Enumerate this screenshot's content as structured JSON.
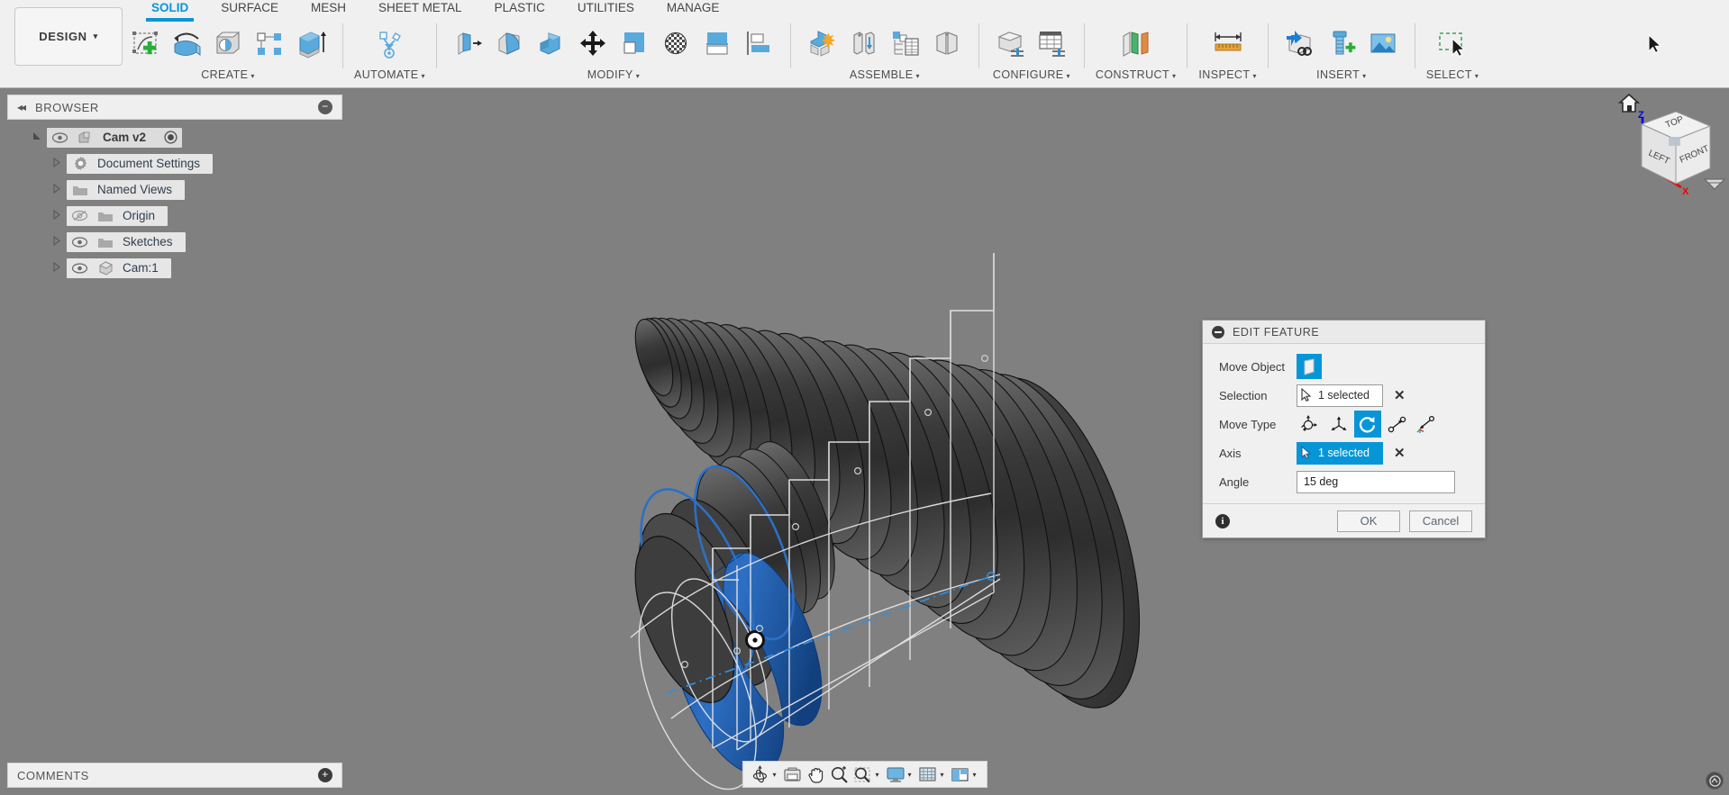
{
  "app": {
    "workspace_label": "DESIGN",
    "workspace_caret": "▾"
  },
  "tabs": [
    {
      "label": "SOLID",
      "active": true
    },
    {
      "label": "SURFACE",
      "active": false
    },
    {
      "label": "MESH",
      "active": false
    },
    {
      "label": "SHEET METAL",
      "active": false
    },
    {
      "label": "PLASTIC",
      "active": false
    },
    {
      "label": "UTILITIES",
      "active": false
    },
    {
      "label": "MANAGE",
      "active": false
    }
  ],
  "ribbon_groups": [
    {
      "name": "CREATE",
      "caret": "▾",
      "tools": [
        "new-sketch-icon",
        "revolve-icon",
        "hole-icon",
        "pattern-icon",
        "extrude-icon"
      ]
    },
    {
      "name": "AUTOMATE",
      "caret": "▾",
      "tools": [
        "automate-icon"
      ]
    },
    {
      "name": "MODIFY",
      "caret": "▾",
      "tools": [
        "press-pull-icon",
        "fillet-icon",
        "shell-icon",
        "move-copy-icon",
        "combine-icon",
        "appearance-icon",
        "align-icon",
        "offset-face-icon"
      ]
    },
    {
      "name": "ASSEMBLE",
      "caret": "▾",
      "tools": [
        "new-component-icon",
        "joint-icon",
        "bom-icon",
        "rigid-group-icon"
      ]
    },
    {
      "name": "CONFIGURE",
      "caret": "▾",
      "tools": [
        "configuration-icon",
        "configuration-table-icon"
      ]
    },
    {
      "name": "CONSTRUCT",
      "caret": "▾",
      "tools": [
        "offset-plane-icon"
      ]
    },
    {
      "name": "INSPECT",
      "caret": "▾",
      "tools": [
        "measure-icon"
      ]
    },
    {
      "name": "INSERT",
      "caret": "▾",
      "tools": [
        "insert-derive-icon",
        "insert-mcmaster-icon",
        "insert-canvas-icon"
      ]
    },
    {
      "name": "SELECT",
      "caret": "▾",
      "tools": [
        "select-window-icon"
      ]
    }
  ],
  "browser": {
    "title": "BROWSER",
    "collapse_icon": "◂◂",
    "minimize_icon": "−",
    "items": [
      {
        "label": "Cam v2",
        "indent": 0,
        "expander": "expanded",
        "eye": "visible",
        "icon": "component-icon",
        "radio": true,
        "bold": true
      },
      {
        "label": "Document Settings",
        "indent": 1,
        "expander": "collapsed",
        "eye": "none",
        "icon": "gear-icon",
        "radio": false,
        "bold": false
      },
      {
        "label": "Named Views",
        "indent": 1,
        "expander": "collapsed",
        "eye": "none",
        "icon": "folder-icon",
        "radio": false,
        "bold": false
      },
      {
        "label": "Origin",
        "indent": 1,
        "expander": "collapsed",
        "eye": "hidden",
        "icon": "folder-icon",
        "radio": false,
        "bold": false
      },
      {
        "label": "Sketches",
        "indent": 1,
        "expander": "collapsed",
        "eye": "visible",
        "icon": "folder-icon",
        "radio": false,
        "bold": false
      },
      {
        "label": "Cam:1",
        "indent": 1,
        "expander": "collapsed",
        "eye": "visible",
        "icon": "body-icon",
        "radio": false,
        "bold": false
      }
    ]
  },
  "dialog": {
    "title": "EDIT FEATURE",
    "rows": {
      "move_object_label": "Move Object",
      "move_object_icon": "face-icon",
      "selection_label": "Selection",
      "selection_value": "1 selected",
      "selection_clear_icon": "✕",
      "move_type_label": "Move Type",
      "move_types": [
        {
          "icon": "free-move-icon",
          "active": false
        },
        {
          "icon": "translate-xyz-icon",
          "active": false
        },
        {
          "icon": "rotate-icon",
          "active": true
        },
        {
          "icon": "point-to-point-icon",
          "active": false
        },
        {
          "icon": "point-to-position-icon",
          "active": false
        }
      ],
      "axis_label": "Axis",
      "axis_value": "1 selected",
      "axis_clear_icon": "✕",
      "angle_label": "Angle",
      "angle_value": "15 deg"
    },
    "footer": {
      "info_icon": "i",
      "ok_label": "OK",
      "cancel_label": "Cancel"
    }
  },
  "comments": {
    "title": "COMMENTS",
    "add_icon": "+"
  },
  "navbar": {
    "items": [
      {
        "icon": "orbit-icon",
        "caret": true
      },
      {
        "icon": "look-at-icon",
        "caret": false
      },
      {
        "icon": "pan-icon",
        "caret": false
      },
      {
        "icon": "zoom-icon",
        "caret": false
      },
      {
        "icon": "zoom-window-icon",
        "caret": true
      },
      {
        "icon": "display-settings-icon",
        "caret": true
      },
      {
        "icon": "grid-snap-icon",
        "caret": true
      },
      {
        "icon": "viewports-icon",
        "caret": true
      }
    ]
  },
  "viewcube": {
    "home_icon": "home-icon",
    "faces": {
      "top": "TOP",
      "left": "LEFT",
      "front": "FRONT"
    },
    "axes": {
      "z": "Z",
      "x": "X"
    },
    "dropdown_icon": "▽"
  },
  "colors": {
    "accent": "#0696d7",
    "canvas_bg": "#808080",
    "ribbon_bg": "#f0f0f0",
    "model_gray": "#4a4a4a",
    "selected_face": "#2060b0",
    "axis_x": "#ff0000",
    "axis_z": "#0000ff"
  }
}
